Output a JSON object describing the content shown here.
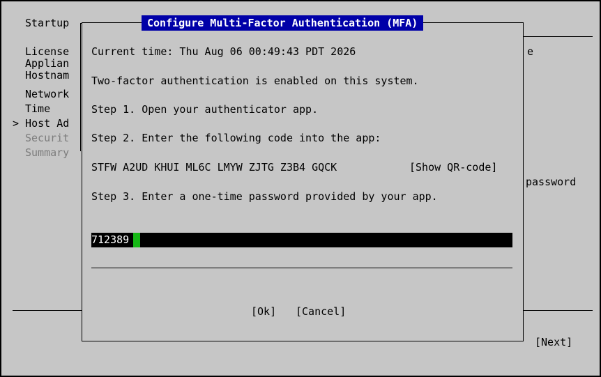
{
  "background": {
    "title": "Startup",
    "nav_items": [
      {
        "label": "License",
        "dim": false
      },
      {
        "label": "Applian",
        "dim": false
      },
      {
        "label": "Hostnam",
        "dim": false
      },
      {
        "label": "Network",
        "dim": false
      },
      {
        "label": "Time",
        "dim": false
      },
      {
        "label": "> Host Ad",
        "dim": false
      },
      {
        "label": "Securit",
        "dim": true
      },
      {
        "label": "Summary",
        "dim": true
      }
    ],
    "right_fragment_1": "e",
    "right_fragment_2": "password",
    "next_label": "[Next]"
  },
  "dialog": {
    "title": "Configure Multi-Factor Authentication (MFA)",
    "current_time": "Current time: Thu Aug 06 00:49:43 PDT 2026",
    "status": "Two-factor authentication is enabled on this system.",
    "step1": "Step 1. Open your authenticator app.",
    "step2": "Step 2. Enter the following code into the app:",
    "secret_code": "STFW A2UD KHUI ML6C LMYW ZJTG Z3B4 GQCK",
    "show_qr_label": "[Show QR-code]",
    "step3": "Step 3. Enter a one-time password provided by your app.",
    "otp_value": "712389",
    "ok_label": "[Ok]",
    "cancel_label": "[Cancel]"
  },
  "colors": {
    "background": "#c6c6c6",
    "title_bg": "#0000a8",
    "title_fg": "#ffffff",
    "input_bg": "#000000",
    "cursor": "#16b816",
    "dim_text": "#7c7c7c"
  }
}
